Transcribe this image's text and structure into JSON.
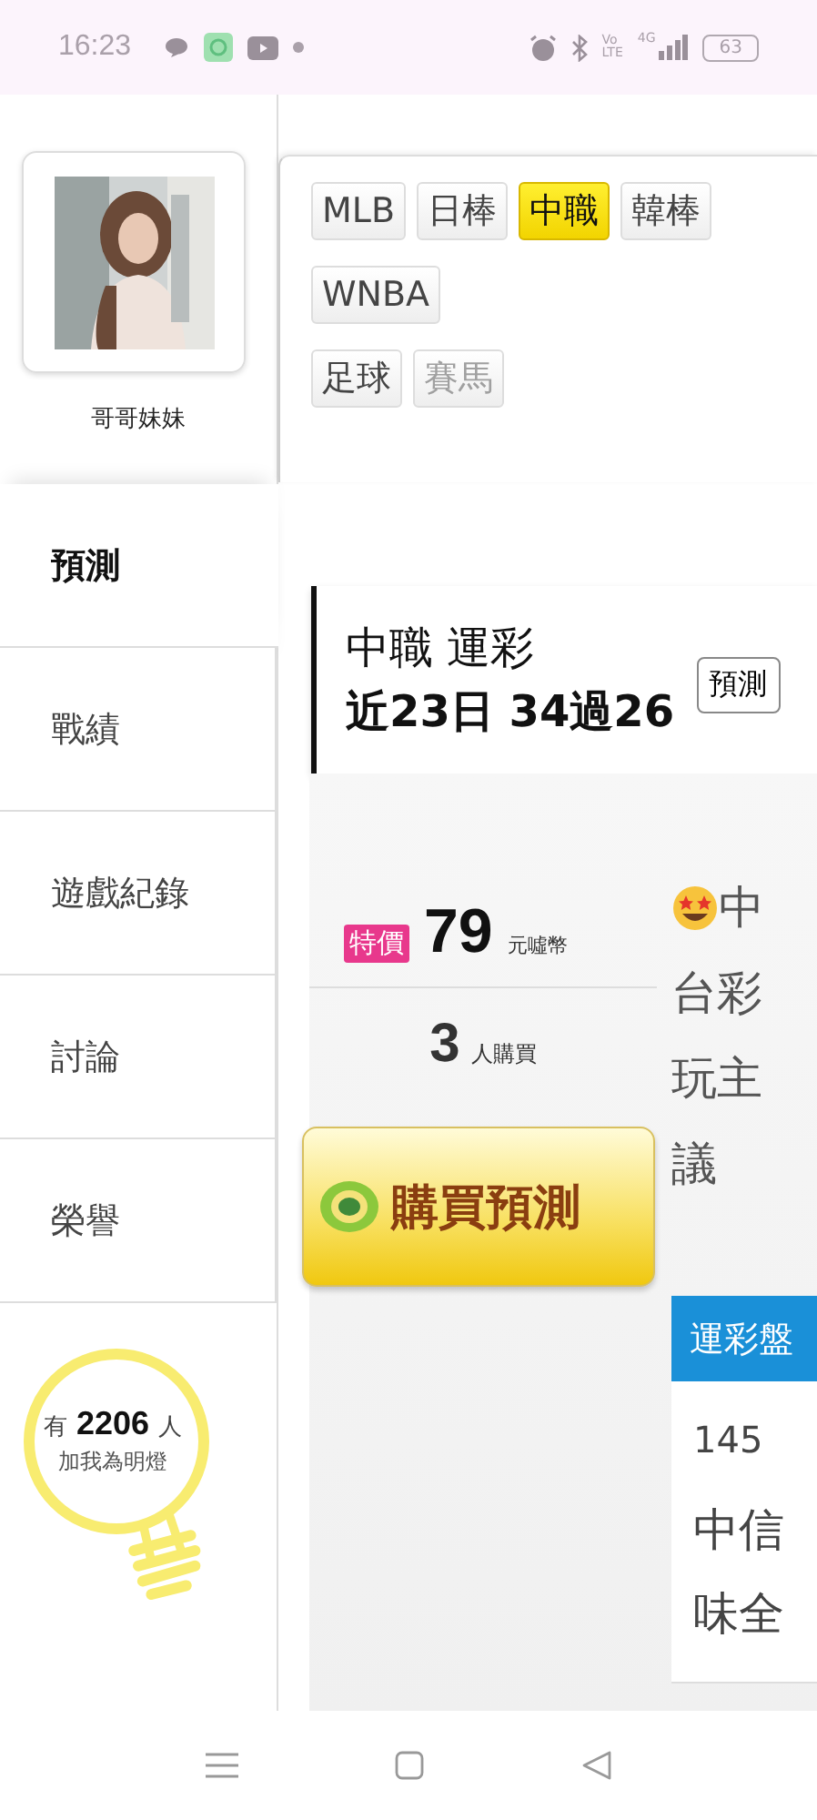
{
  "status_bar": {
    "time": "16:23",
    "volte_top": "Vo",
    "volte_bottom": "LTE",
    "network": "4G",
    "battery": "63"
  },
  "profile": {
    "name": "哥哥妹妹"
  },
  "sidebar": {
    "items": [
      {
        "label": "預測",
        "selected": true
      },
      {
        "label": "戰績",
        "selected": false
      },
      {
        "label": "遊戲紀錄",
        "selected": false
      },
      {
        "label": "討論",
        "selected": false
      },
      {
        "label": "榮譽",
        "selected": false
      }
    ]
  },
  "fans": {
    "prefix": "有",
    "count": "2206",
    "suffix": "人",
    "caption": "加我為明燈"
  },
  "sport_tabs": [
    [
      {
        "label": "MLB",
        "selected": false,
        "disabled": false
      },
      {
        "label": "日棒",
        "selected": false,
        "disabled": false
      },
      {
        "label": "中職",
        "selected": true,
        "disabled": false
      },
      {
        "label": "韓棒",
        "selected": false,
        "disabled": false
      }
    ],
    [
      {
        "label": "WNBA",
        "selected": false,
        "disabled": false
      }
    ],
    [
      {
        "label": "足球",
        "selected": false,
        "disabled": false
      },
      {
        "label": "賽馬",
        "selected": false,
        "disabled": true
      }
    ]
  ],
  "header": {
    "title": "中職 運彩",
    "record": "近23日 34過26",
    "button": "預測"
  },
  "offer": {
    "badge": "特價",
    "price": "79",
    "unit": "元噓幣",
    "buyers": "3",
    "buyers_label": "人購買",
    "buy_button": "購買預測"
  },
  "description": {
    "lines": [
      "中",
      "台彩",
      "玩主",
      "議"
    ]
  },
  "table": {
    "header": "運彩盤",
    "number": "145",
    "teams": [
      "中信",
      "味全"
    ]
  }
}
